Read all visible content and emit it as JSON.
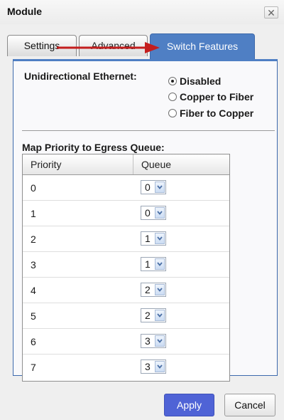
{
  "window": {
    "title": "Module",
    "close_glyph": "✕"
  },
  "tabs": [
    {
      "label": "Settings",
      "active": false
    },
    {
      "label": "Advanced",
      "active": false
    },
    {
      "label": "Switch Features",
      "active": true
    }
  ],
  "unidirectional": {
    "label": "Unidirectional Ethernet:",
    "options": [
      {
        "label": "Disabled",
        "selected": true
      },
      {
        "label": "Copper to Fiber",
        "selected": false
      },
      {
        "label": "Fiber to Copper",
        "selected": false
      }
    ]
  },
  "priority_map": {
    "title": "Map Priority to Egress Queue:",
    "columns": [
      "Priority",
      "Queue"
    ],
    "rows": [
      {
        "priority": "0",
        "queue": "0"
      },
      {
        "priority": "1",
        "queue": "0"
      },
      {
        "priority": "2",
        "queue": "1"
      },
      {
        "priority": "3",
        "queue": "1"
      },
      {
        "priority": "4",
        "queue": "2"
      },
      {
        "priority": "5",
        "queue": "2"
      },
      {
        "priority": "6",
        "queue": "3"
      },
      {
        "priority": "7",
        "queue": "3"
      }
    ]
  },
  "buttons": {
    "apply": "Apply",
    "cancel": "Cancel"
  },
  "colors": {
    "active_tab": "#4f7fc4",
    "apply_button": "#4f63d6",
    "annotation_arrow": "#c41e1e"
  },
  "icons": {
    "close": "close-icon",
    "dropdown": "chevron-down-icon",
    "annotation": "red-arrow-icon"
  }
}
